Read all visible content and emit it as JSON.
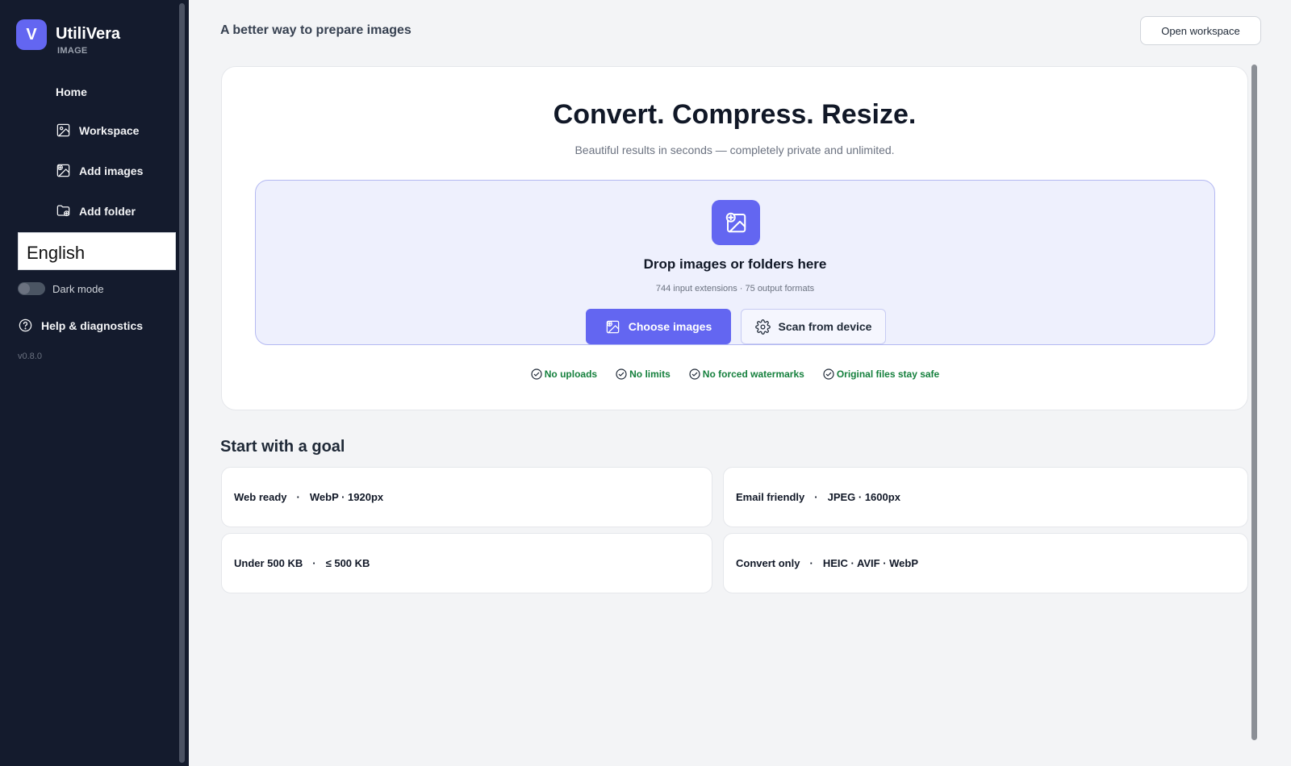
{
  "app": {
    "logo_letter": "V",
    "name": "UtiliVera",
    "subtitle": "IMAGE",
    "accent_color": "#6366f1",
    "sidebar_color": "#141b2d"
  },
  "sidebar": {
    "items": [
      {
        "label": "Home",
        "icon": "none"
      },
      {
        "label": "Workspace",
        "icon": "image-gallery-icon"
      },
      {
        "label": "Add images",
        "icon": "add-image-icon"
      },
      {
        "label": "Add folder",
        "icon": "add-folder-icon"
      }
    ],
    "language": "English",
    "dark_mode_label": "Dark mode",
    "dark_mode_on": false,
    "help_label": "Help & diagnostics",
    "version": "v0.8.0"
  },
  "header": {
    "title": "A better way to prepare images",
    "open_workspace": "Open workspace"
  },
  "hero": {
    "title": "Convert. Compress. Resize.",
    "subtitle": "Beautiful results in seconds — completely private and unlimited.",
    "drop_title": "Drop images or folders here",
    "drop_sub": "744 input extensions · 75 output formats",
    "choose_label": "Choose images",
    "scan_label": "Scan from device",
    "badges": [
      "No uploads",
      "No limits",
      "No forced watermarks",
      "Original files stay safe"
    ],
    "badge_color": "#15803d"
  },
  "goals": {
    "title": "Start with a goal",
    "cards": [
      {
        "name": "Web ready",
        "sep": "·",
        "detail": "WebP · 1920px"
      },
      {
        "name": "Email friendly",
        "sep": "·",
        "detail": "JPEG · 1600px"
      },
      {
        "name": "Under 500 KB",
        "sep": "·",
        "detail": "≤ 500 KB"
      },
      {
        "name": "Convert only",
        "sep": "·",
        "detail": "HEIC · AVIF · WebP"
      }
    ]
  }
}
